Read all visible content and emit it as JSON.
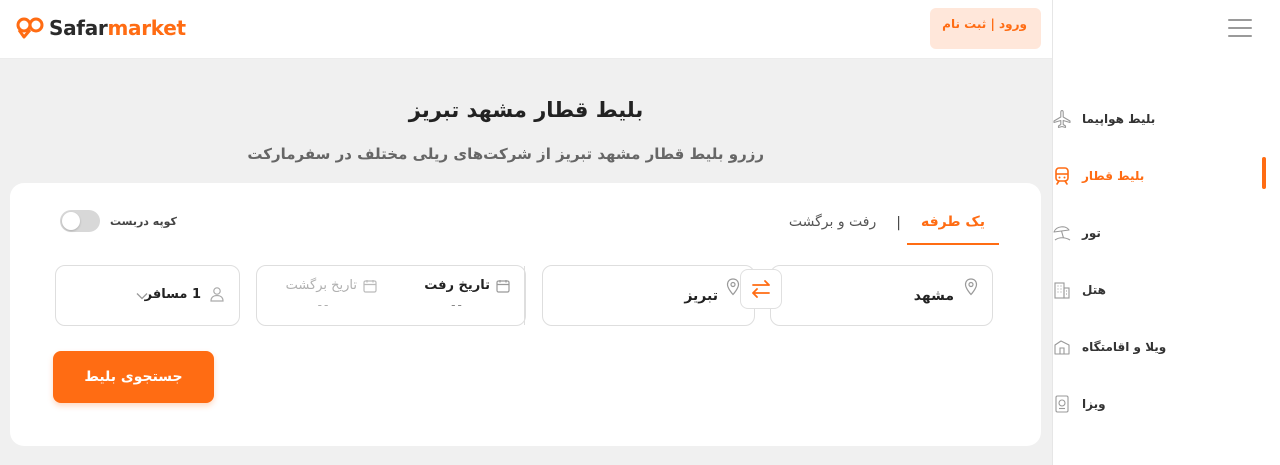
{
  "brand": {
    "part1": "Safar",
    "part2": "market",
    "primary_color": "#ff6c13"
  },
  "header": {
    "login_label": "ورود | ثبت نام"
  },
  "page": {
    "title": "بلیط قطار مشهد تبریز",
    "subtitle": "رزرو بلیط قطار مشهد تبریز از شرکت‌های ریلی مختلف در سفرمارکت"
  },
  "search": {
    "tabs": [
      {
        "label": "یک طرفه",
        "active": true
      },
      {
        "label": "رفت و برگشت",
        "active": false
      }
    ],
    "tab_separator": "|",
    "coupe_label": "کوپه دربست",
    "coupe_enabled": false,
    "origin": "مشهد",
    "destination": "تبریز",
    "depart_label": "تاریخ رفت",
    "depart_value": "--",
    "return_label": "تاریخ برگشت",
    "return_value": "--",
    "passengers": "1 مسافر",
    "submit_label": "جستجوی بلیط"
  },
  "sidebar": {
    "items": [
      {
        "label": "بلیط هواپیما",
        "icon": "plane-icon",
        "active": false
      },
      {
        "label": "بلیط قطار",
        "icon": "train-icon",
        "active": true
      },
      {
        "label": "تور",
        "icon": "tour-icon",
        "active": false
      },
      {
        "label": "هتل",
        "icon": "hotel-icon",
        "active": false
      },
      {
        "label": "ویلا و اقامتگاه",
        "icon": "villa-icon",
        "active": false
      },
      {
        "label": "ویزا",
        "icon": "visa-icon",
        "active": false
      }
    ]
  }
}
